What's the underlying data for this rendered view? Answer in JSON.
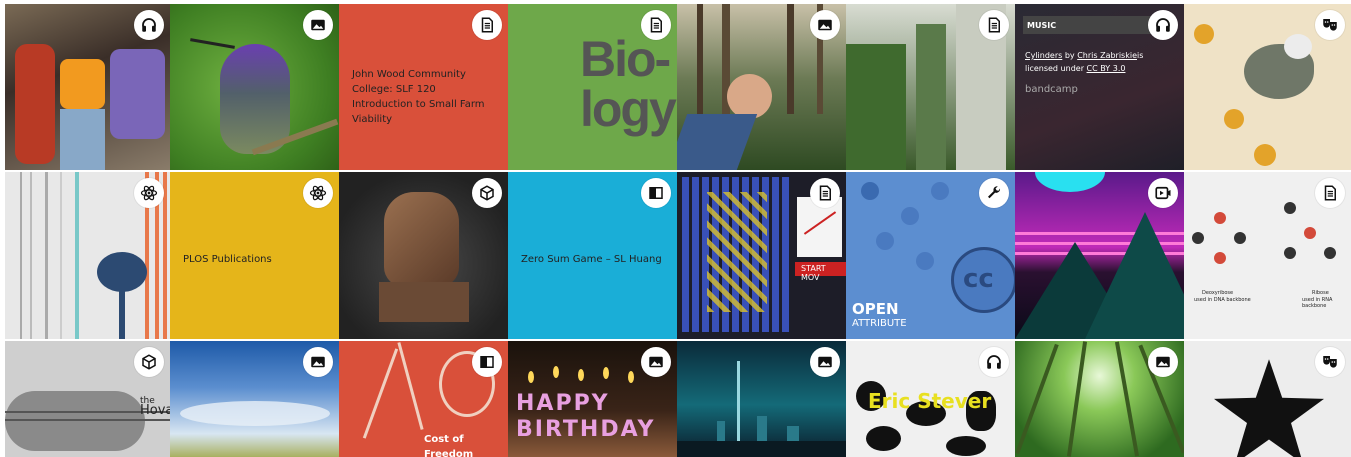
{
  "tiles": {
    "r1c1": {
      "icon": "headphones-icon"
    },
    "r1c2": {
      "icon": "image-icon"
    },
    "r1c3": {
      "icon": "document-icon",
      "text": "John Wood Community College: SLF 120 Introduction to Small Farm Viability"
    },
    "r1c4": {
      "icon": "document-icon",
      "big_text_1": "Bio-",
      "big_text_2": "logy"
    },
    "r1c5": {
      "icon": "image-icon"
    },
    "r1c6": {
      "icon": "document-icon"
    },
    "r1c7": {
      "icon": "headphones-icon",
      "label": "MUSIC",
      "link1": "Cylinders",
      "by": " by ",
      "link2": "Chris Zabriskie",
      "mid": "is licensed under ",
      "link3": "CC BY 3.0",
      "brand": "bandcamp"
    },
    "r1c8": {
      "icon": "theater-masks-icon"
    },
    "r2c1": {
      "icon": "atom-icon"
    },
    "r2c2": {
      "icon": "atom-icon",
      "text": "PLOS Publications"
    },
    "r2c3": {
      "icon": "cube-icon"
    },
    "r2c4": {
      "icon": "book-icon",
      "text": "Zero Sum Game – SL Huang"
    },
    "r2c5": {
      "icon": "document-icon",
      "button": "START MOV"
    },
    "r2c6": {
      "icon": "wrench-icon",
      "brand1": "OPEN",
      "brand2": "ATTRIBUTE",
      "cc": "cc"
    },
    "r2c7": {
      "icon": "video-icon"
    },
    "r2c8": {
      "icon": "document-icon",
      "cap1": "Deoxyribose",
      "cap1b": "used in DNA backbone",
      "cap2": "Ribose",
      "cap2b": "used in RNA backbone"
    },
    "r3c1": {
      "icon": "cube-icon",
      "text1": "the",
      "text2": "Hova"
    },
    "r3c2": {
      "icon": "image-icon"
    },
    "r3c3": {
      "icon": "book-icon",
      "text": "Cost of Freedom"
    },
    "r3c4": {
      "icon": "image-icon",
      "candles": "HAPPY BIRTHDAY"
    },
    "r3c5": {
      "icon": "image-icon"
    },
    "r3c6": {
      "icon": "headphones-icon",
      "poster": "Eric Stever"
    },
    "r3c7": {
      "icon": "image-icon"
    },
    "r3c8": {
      "icon": "theater-masks-icon"
    }
  },
  "colors": {
    "red": "#d9503a",
    "green": "#6ea84a",
    "yellow": "#e5b51a",
    "cyan": "#1aaed7",
    "blue": "#5c8ed0",
    "dark": "#1d1d1d"
  }
}
